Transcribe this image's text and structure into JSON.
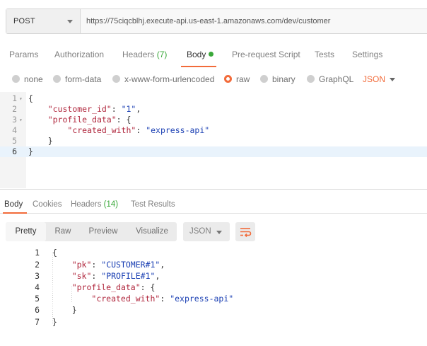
{
  "request": {
    "method": "POST",
    "url": "https://75ciqcblhj.execute-api.us-east-1.amazonaws.com/dev/customer"
  },
  "request_tabs": [
    {
      "label": "Params"
    },
    {
      "label": "Authorization"
    },
    {
      "label": "Headers",
      "count": "(7)"
    },
    {
      "label": "Body"
    },
    {
      "label": "Pre-request Script"
    },
    {
      "label": "Tests"
    },
    {
      "label": "Settings"
    }
  ],
  "body_types": [
    {
      "label": "none"
    },
    {
      "label": "form-data"
    },
    {
      "label": "x-www-form-urlencoded"
    },
    {
      "label": "raw"
    },
    {
      "label": "binary"
    },
    {
      "label": "GraphQL"
    }
  ],
  "body_format": "JSON",
  "request_editor": {
    "line_numbers": [
      "1",
      "2",
      "3",
      "4",
      "5",
      "6"
    ],
    "fold_markers": [
      "▾",
      "▾"
    ],
    "line2": {
      "key": "\"customer_id\"",
      "colon": ": ",
      "value": "\"1\"",
      "end": ","
    },
    "line3": {
      "key": "\"profile_data\"",
      "end": ": {"
    },
    "line4": {
      "key": "\"created_with\"",
      "colon": ": ",
      "value": "\"express-api\""
    },
    "open": "{",
    "close_inner": "}",
    "close": "}"
  },
  "response_tabs": [
    {
      "label": "Body"
    },
    {
      "label": "Cookies"
    },
    {
      "label": "Headers",
      "count": "(14)"
    },
    {
      "label": "Test Results"
    }
  ],
  "view_modes": [
    "Pretty",
    "Raw",
    "Preview",
    "Visualize"
  ],
  "response_format": "JSON",
  "response_body": {
    "line_numbers": [
      "1",
      "2",
      "3",
      "4",
      "5",
      "6",
      "7"
    ],
    "open": "{",
    "pk": {
      "key": "\"pk\"",
      "colon": ": ",
      "value": "\"CUSTOMER#1\"",
      "end": ","
    },
    "sk": {
      "key": "\"sk\"",
      "colon": ": ",
      "value": "\"PROFILE#1\"",
      "end": ","
    },
    "profile": {
      "key": "\"profile_data\"",
      "end": ": {"
    },
    "created": {
      "key": "\"created_with\"",
      "colon": ": ",
      "value": "\"express-api\""
    },
    "close_inner": "}",
    "close": "}"
  },
  "colors": {
    "accent": "#f26b3a",
    "success": "#3aa83a",
    "key": "#b0263c",
    "string": "#1a3fb3"
  }
}
